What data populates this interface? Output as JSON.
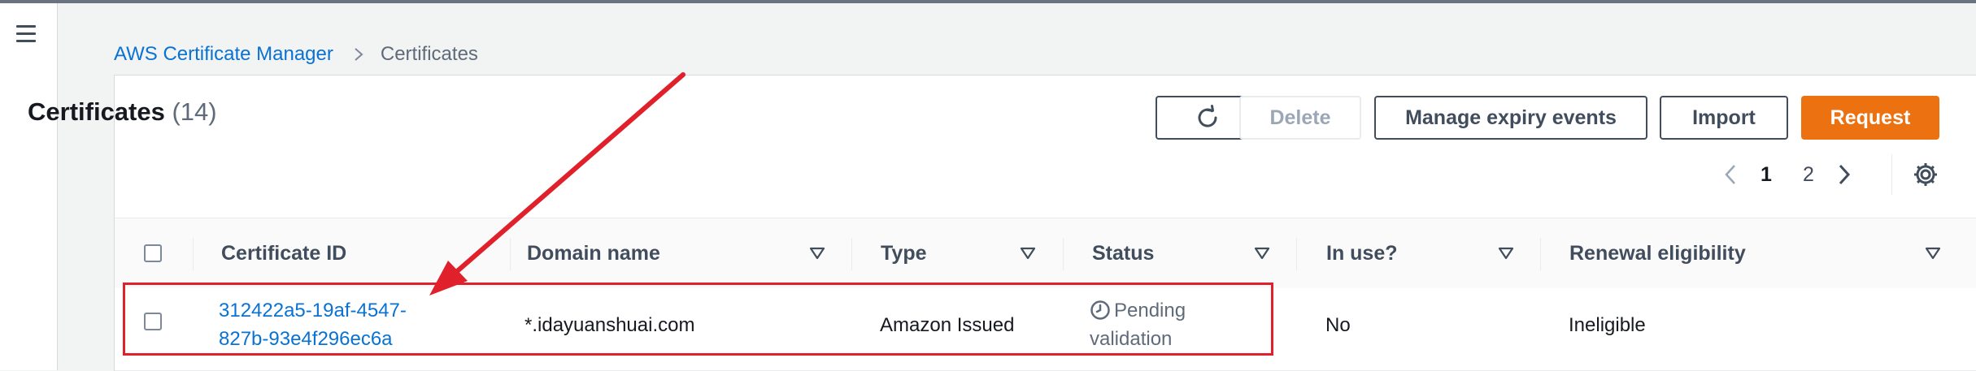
{
  "nav": {
    "menu_icon": "hamburger-menu-icon"
  },
  "breadcrumb": {
    "parent": "AWS Certificate Manager",
    "current": "Certificates"
  },
  "panel": {
    "title": "Certificates",
    "count": "(14)"
  },
  "toolbar": {
    "refresh_icon": "refresh-icon",
    "delete_label": "Delete",
    "manage_label": "Manage expiry events",
    "import_label": "Import",
    "request_label": "Request"
  },
  "pagination": {
    "pages": [
      "1",
      "2"
    ],
    "current_page": "1"
  },
  "table": {
    "columns": [
      "Certificate ID",
      "Domain name",
      "Type",
      "Status",
      "In use?",
      "Renewal eligibility"
    ],
    "rows": [
      {
        "certificate_id_line1": "312422a5-19af-4547-",
        "certificate_id_line2": "827b-93e4f296ec6a",
        "domain_name": "*.idayuanshuai.com",
        "type": "Amazon Issued",
        "status_line1": "Pending",
        "status_line2": "validation",
        "in_use": "No",
        "renewal_eligibility": "Ineligible"
      }
    ]
  },
  "colors": {
    "link": "#0972d3",
    "primary_button": "#ec7211",
    "annotation": "#e0202a"
  }
}
